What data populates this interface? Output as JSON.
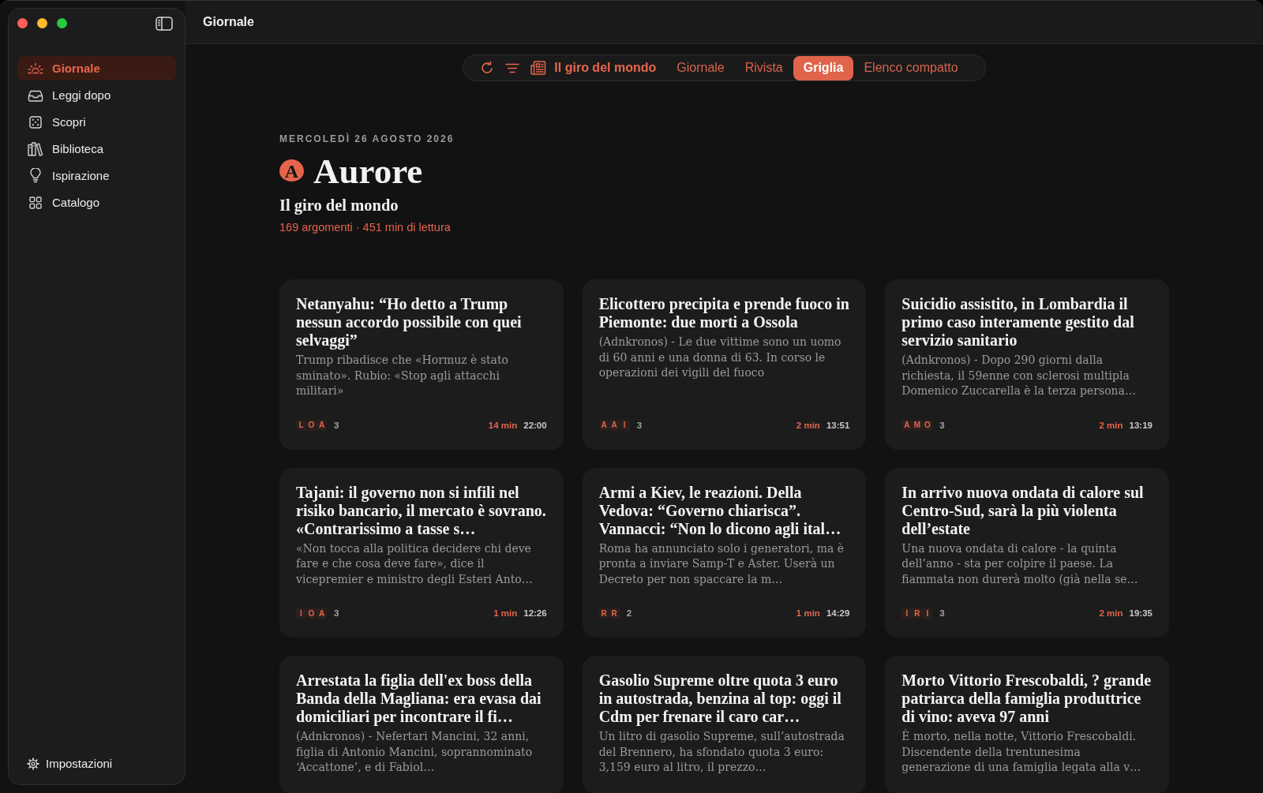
{
  "window": {
    "title": "Giornale"
  },
  "sidebar": {
    "items": [
      {
        "label": "Giornale",
        "selected": true
      },
      {
        "label": "Leggi dopo",
        "selected": false
      },
      {
        "label": "Scopri",
        "selected": false
      },
      {
        "label": "Biblioteca",
        "selected": false
      },
      {
        "label": "Ispirazione",
        "selected": false
      },
      {
        "label": "Catalogo",
        "selected": false
      }
    ],
    "settings": "Impostazioni"
  },
  "toolbar": {
    "feed": "Il giro del mondo",
    "views": [
      {
        "label": "Giornale",
        "selected": false
      },
      {
        "label": "Rivista",
        "selected": false
      },
      {
        "label": "Griglia",
        "selected": true
      },
      {
        "label": "Elenco compatto",
        "selected": false
      }
    ]
  },
  "header": {
    "date": "MERCOLEDÌ 26 AGOSTO 2026",
    "logo_letter": "A",
    "title": "Aurore",
    "subtitle": "Il giro del mondo",
    "stats": "169 argomenti · 451 min di lettura"
  },
  "articles": [
    {
      "title": "Netanyahu: “Ho detto a Trump nessun accordo possibile con quei selvaggi”",
      "summary": "Trump ribadisce che «Hormuz è stato sminato». Rubio: «Stop agli attacchi militari»",
      "sources": [
        "L",
        "O",
        "A"
      ],
      "count": "3",
      "read_time": "14 min",
      "time": "22:00"
    },
    {
      "title": "Elicottero precipita e prende fuoco in Piemonte: due morti a Ossola",
      "summary": "(Adnkronos) - Le due vittime sono un uomo di 60 anni e una donna di 63. In corso le operazioni dei vigili del fuoco",
      "sources": [
        "A",
        "A",
        "I"
      ],
      "count": "3",
      "read_time": "2 min",
      "time": "13:51"
    },
    {
      "title": "Suicidio assistito, in Lombardia il primo caso interamente gestito dal servizio sanitario",
      "summary": "(Adnkronos) - Dopo 290 giorni dalla richiesta, il 59enne con sclerosi multipla Domenico Zuccarella è la terza persona…",
      "sources": [
        "A",
        "M",
        "O"
      ],
      "count": "3",
      "read_time": "2 min",
      "time": "13:19"
    },
    {
      "title": "Tajani: il governo non si infili nel risiko bancario, il mercato è sovrano. «Contrarissimo a tasse s…",
      "summary": "«Non tocca alla politica decidere chi deve fare e che cosa deve fare», dice il vicepremier e ministro degli Esteri Anto…",
      "sources": [
        "I",
        "O",
        "A"
      ],
      "count": "3",
      "read_time": "1 min",
      "time": "12:26"
    },
    {
      "title": "Armi a Kiev, le reazioni. Della Vedova: “Governo chiarisca”. Vannacci: “Non lo dicono agli ital…",
      "summary": "Roma ha annunciato solo i generatori, ma è pronta a inviare Samp-T e Aster. Userà un Decreto per non spaccare la m…",
      "sources": [
        "R",
        "R"
      ],
      "count": "2",
      "read_time": "1 min",
      "time": "14:29"
    },
    {
      "title": "In arrivo nuova ondata di calore sul Centro-Sud, sarà la più violenta dell’estate",
      "summary": "Una nuova ondata di calore - la quinta dell’anno - sta per colpire il paese. La fiammata non durerà molto (già nella se…",
      "sources": [
        "I",
        "R",
        "I"
      ],
      "count": "3",
      "read_time": "2 min",
      "time": "19:35"
    },
    {
      "title": "Arrestata la figlia dell'ex boss della Banda della Magliana: era evasa dai domiciliari per incontrare il fi…",
      "summary": "(Adnkronos) - Nefertari Mancini, 32 anni, figlia di Antonio Mancini, soprannominato ‘Accattone’, e di Fabiol…"
    },
    {
      "title": "Gasolio Supreme oltre quota 3 euro in autostrada, benzina al top: oggi il Cdm per frenare il caro car…",
      "summary": "Un litro di gasolio Supreme, sull’autostrada del Brennero, ha sfondato quota 3 euro: 3,159 euro al litro, il prezzo…"
    },
    {
      "title": "Morto Vittorio Frescobaldi, ? grande patriarca della famiglia produttrice di vino: aveva 97 anni",
      "summary": "È morto, nella notte, Vittorio Frescobaldi. Discendente della trentunesima generazione di una famiglia legata alla v…"
    }
  ]
}
